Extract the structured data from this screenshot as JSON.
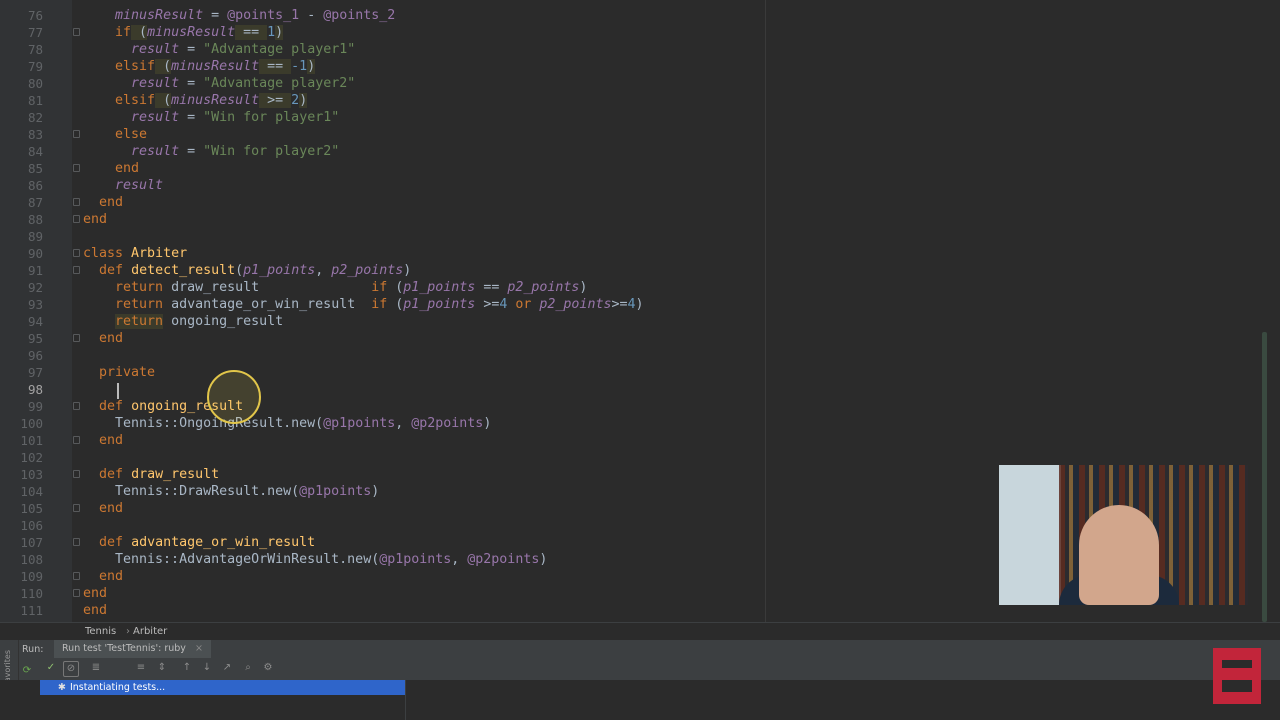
{
  "editor": {
    "lines": [
      {
        "n": "76",
        "tokens": [
          {
            "t": "    "
          },
          {
            "t": "minusResult",
            "c": "lv"
          },
          {
            "t": " = "
          },
          {
            "t": "@points_1",
            "c": "iv"
          },
          {
            "t": " - "
          },
          {
            "t": "@points_2",
            "c": "iv"
          }
        ]
      },
      {
        "n": "77",
        "tokens": [
          {
            "t": "    "
          },
          {
            "t": "if",
            "c": "kw"
          },
          {
            "t": " (",
            "c": "hl2"
          },
          {
            "t": "minusResult",
            "c": "lv"
          },
          {
            "t": " == ",
            "c": "hl2"
          },
          {
            "t": "1",
            "c": "num"
          },
          {
            "t": ")",
            "c": "hl2"
          }
        ]
      },
      {
        "n": "78",
        "tokens": [
          {
            "t": "      "
          },
          {
            "t": "result",
            "c": "lv"
          },
          {
            "t": " = "
          },
          {
            "t": "\"Advantage player1\"",
            "c": "st"
          }
        ]
      },
      {
        "n": "79",
        "tokens": [
          {
            "t": "    "
          },
          {
            "t": "elsif",
            "c": "kw"
          },
          {
            "t": " (",
            "c": "hl2"
          },
          {
            "t": "minusResult",
            "c": "lv"
          },
          {
            "t": " == ",
            "c": "hl2"
          },
          {
            "t": "-1",
            "c": "num"
          },
          {
            "t": ")",
            "c": "hl2"
          }
        ]
      },
      {
        "n": "80",
        "tokens": [
          {
            "t": "      "
          },
          {
            "t": "result",
            "c": "lv"
          },
          {
            "t": " = "
          },
          {
            "t": "\"Advantage player2\"",
            "c": "st"
          }
        ]
      },
      {
        "n": "81",
        "tokens": [
          {
            "t": "    "
          },
          {
            "t": "elsif",
            "c": "kw"
          },
          {
            "t": " (",
            "c": "hl2"
          },
          {
            "t": "minusResult",
            "c": "lv"
          },
          {
            "t": " >= ",
            "c": "hl2"
          },
          {
            "t": "2",
            "c": "num"
          },
          {
            "t": ")",
            "c": "hl2"
          }
        ]
      },
      {
        "n": "82",
        "tokens": [
          {
            "t": "      "
          },
          {
            "t": "result",
            "c": "lv"
          },
          {
            "t": " = "
          },
          {
            "t": "\"Win for player1\"",
            "c": "st"
          }
        ]
      },
      {
        "n": "83",
        "tokens": [
          {
            "t": "    "
          },
          {
            "t": "else",
            "c": "kw"
          }
        ]
      },
      {
        "n": "84",
        "tokens": [
          {
            "t": "      "
          },
          {
            "t": "result",
            "c": "lv"
          },
          {
            "t": " = "
          },
          {
            "t": "\"Win for player2\"",
            "c": "st"
          }
        ]
      },
      {
        "n": "85",
        "tokens": [
          {
            "t": "    "
          },
          {
            "t": "end",
            "c": "kw"
          }
        ]
      },
      {
        "n": "86",
        "tokens": [
          {
            "t": "    "
          },
          {
            "t": "result",
            "c": "lv"
          }
        ]
      },
      {
        "n": "87",
        "tokens": [
          {
            "t": "  "
          },
          {
            "t": "end",
            "c": "kw"
          }
        ]
      },
      {
        "n": "88",
        "tokens": [
          {
            "t": "end",
            "c": "kw"
          }
        ]
      },
      {
        "n": "89",
        "tokens": []
      },
      {
        "n": "90",
        "tokens": [
          {
            "t": "class",
            "c": "kw"
          },
          {
            "t": " "
          },
          {
            "t": "Arbiter",
            "c": "cl"
          }
        ]
      },
      {
        "n": "91",
        "tokens": [
          {
            "t": "  "
          },
          {
            "t": "def",
            "c": "kw"
          },
          {
            "t": " "
          },
          {
            "t": "detect_result",
            "c": "fn"
          },
          {
            "t": "("
          },
          {
            "t": "p1_points",
            "c": "lv"
          },
          {
            "t": ", "
          },
          {
            "t": "p2_points",
            "c": "lv"
          },
          {
            "t": ")"
          }
        ]
      },
      {
        "n": "92",
        "tokens": [
          {
            "t": "    "
          },
          {
            "t": "return",
            "c": "kw"
          },
          {
            "t": " draw_result              "
          },
          {
            "t": "if",
            "c": "kw"
          },
          {
            "t": " ("
          },
          {
            "t": "p1_points",
            "c": "lv"
          },
          {
            "t": " == "
          },
          {
            "t": "p2_points",
            "c": "lv"
          },
          {
            "t": ")"
          }
        ]
      },
      {
        "n": "93",
        "tokens": [
          {
            "t": "    "
          },
          {
            "t": "return",
            "c": "kw"
          },
          {
            "t": " advantage_or_win_result  "
          },
          {
            "t": "if",
            "c": "kw"
          },
          {
            "t": " ("
          },
          {
            "t": "p1_points",
            "c": "lv"
          },
          {
            "t": " >="
          },
          {
            "t": "4",
            "c": "num"
          },
          {
            "t": " "
          },
          {
            "t": "or",
            "c": "kw"
          },
          {
            "t": " "
          },
          {
            "t": "p2_points",
            "c": "lv"
          },
          {
            "t": ">="
          },
          {
            "t": "4",
            "c": "num"
          },
          {
            "t": ")"
          }
        ]
      },
      {
        "n": "94",
        "tokens": [
          {
            "t": "    "
          },
          {
            "t": "return",
            "c": "kw hl2"
          },
          {
            "t": " ongoing_result"
          }
        ]
      },
      {
        "n": "95",
        "tokens": [
          {
            "t": "  "
          },
          {
            "t": "end",
            "c": "kw"
          }
        ]
      },
      {
        "n": "96",
        "tokens": []
      },
      {
        "n": "97",
        "tokens": [
          {
            "t": "  "
          },
          {
            "t": "private",
            "c": "pr"
          }
        ]
      },
      {
        "n": "98",
        "tokens": []
      },
      {
        "n": "99",
        "tokens": [
          {
            "t": "  "
          },
          {
            "t": "def",
            "c": "kw"
          },
          {
            "t": " "
          },
          {
            "t": "ongoing_result",
            "c": "fn"
          }
        ]
      },
      {
        "n": "100",
        "tokens": [
          {
            "t": "    Tennis::OngoingResult.new("
          },
          {
            "t": "@p1points",
            "c": "iv"
          },
          {
            "t": ", "
          },
          {
            "t": "@p2points",
            "c": "iv"
          },
          {
            "t": ")"
          }
        ]
      },
      {
        "n": "101",
        "tokens": [
          {
            "t": "  "
          },
          {
            "t": "end",
            "c": "kw"
          }
        ]
      },
      {
        "n": "102",
        "tokens": []
      },
      {
        "n": "103",
        "tokens": [
          {
            "t": "  "
          },
          {
            "t": "def",
            "c": "kw"
          },
          {
            "t": " "
          },
          {
            "t": "draw_result",
            "c": "fn"
          }
        ]
      },
      {
        "n": "104",
        "tokens": [
          {
            "t": "    Tennis::DrawResult.new("
          },
          {
            "t": "@p1points",
            "c": "iv"
          },
          {
            "t": ")"
          }
        ]
      },
      {
        "n": "105",
        "tokens": [
          {
            "t": "  "
          },
          {
            "t": "end",
            "c": "kw"
          }
        ]
      },
      {
        "n": "106",
        "tokens": []
      },
      {
        "n": "107",
        "tokens": [
          {
            "t": "  "
          },
          {
            "t": "def",
            "c": "kw"
          },
          {
            "t": " "
          },
          {
            "t": "advantage_or_win_result",
            "c": "fn"
          }
        ]
      },
      {
        "n": "108",
        "tokens": [
          {
            "t": "    Tennis::AdvantageOrWinResult.new("
          },
          {
            "t": "@p1points",
            "c": "iv"
          },
          {
            "t": ", "
          },
          {
            "t": "@p2points",
            "c": "iv"
          },
          {
            "t": ")"
          }
        ]
      },
      {
        "n": "109",
        "tokens": [
          {
            "t": "  "
          },
          {
            "t": "end",
            "c": "kw"
          }
        ]
      },
      {
        "n": "110",
        "tokens": [
          {
            "t": "end",
            "c": "kw"
          }
        ]
      },
      {
        "n": "111",
        "tokens": [
          {
            "t": "end",
            "c": "kw"
          }
        ]
      }
    ],
    "current_line": "98"
  },
  "breadcrumb": {
    "items": [
      "Tennis",
      "Arbiter"
    ]
  },
  "run": {
    "label": "Run:",
    "tab_label": "Run test 'TestTennis': ruby",
    "status_text": "Instantiating tests...",
    "side_label": "2: Favorites"
  },
  "colors": {
    "accent": "#2f65ca",
    "logo": "#c2253a"
  }
}
